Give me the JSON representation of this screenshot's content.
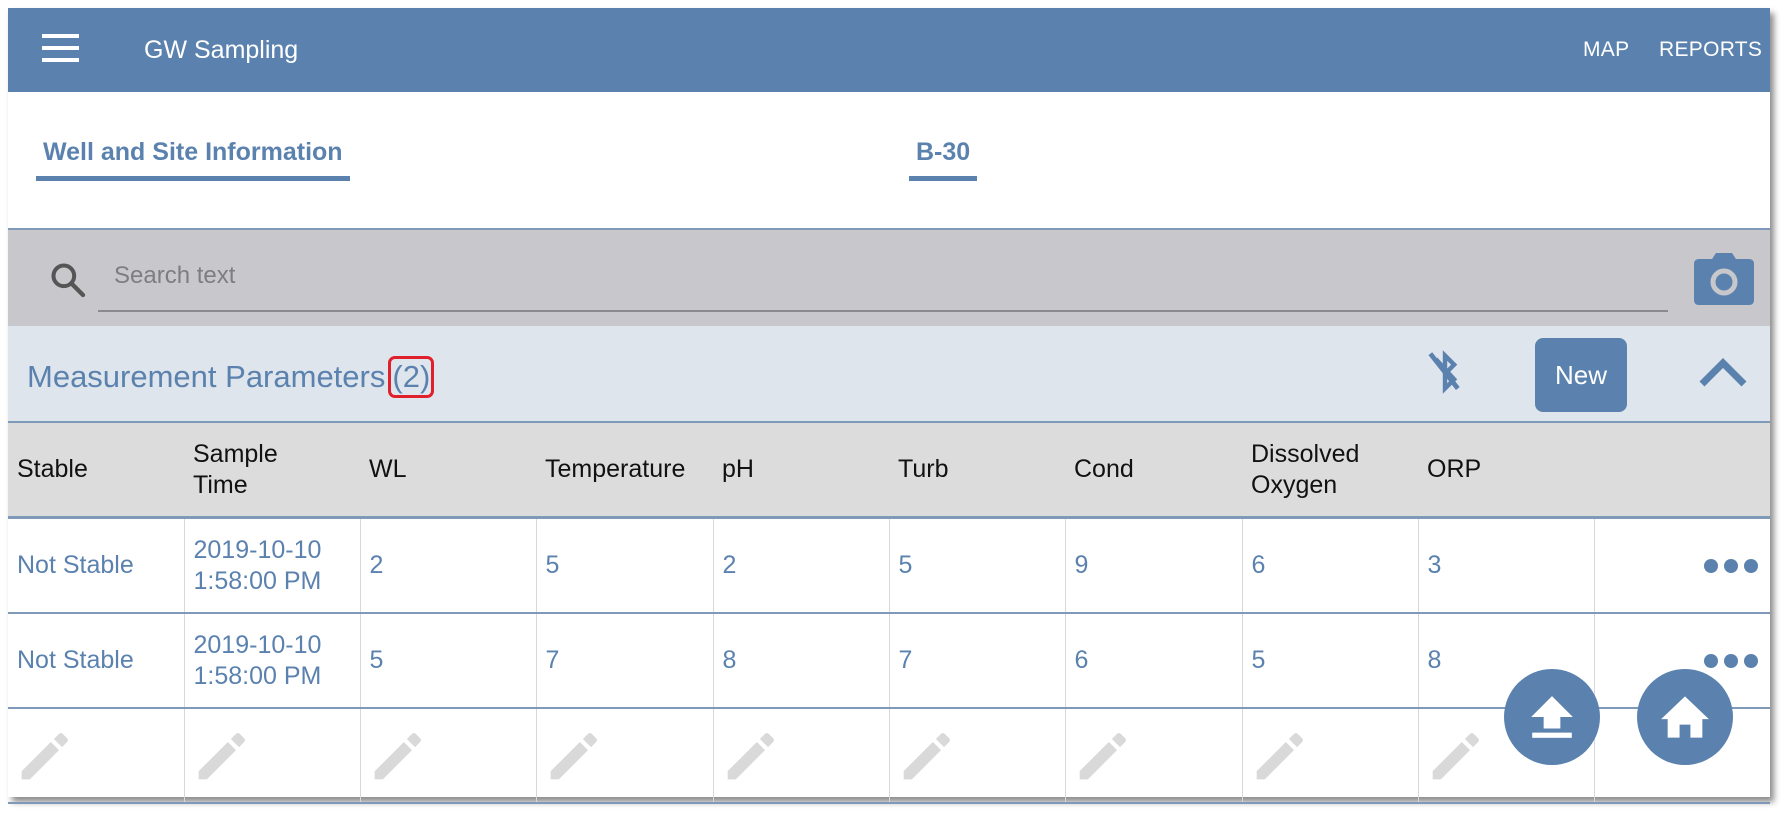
{
  "app": {
    "title": "GW Sampling",
    "nav": [
      {
        "label": "MAP"
      },
      {
        "label": "REPORTS"
      }
    ]
  },
  "tabs": [
    {
      "label": "Well and Site Information"
    },
    {
      "label": "B-30"
    }
  ],
  "search": {
    "placeholder": "Search text",
    "value": ""
  },
  "section": {
    "title": "Measurement Parameters",
    "count": "(2)",
    "new_label": "New",
    "icons": {
      "bluetooth": "bluetooth-disabled-icon",
      "collapse": "chevron-up-icon",
      "camera": "camera-icon",
      "search": "search-icon"
    }
  },
  "table": {
    "columns": [
      "Stable",
      "Sample\nTime",
      "WL",
      "Temperature",
      "pH",
      "Turb",
      "Cond",
      "Dissolved\nOxygen",
      "ORP",
      ""
    ],
    "columns_display": {
      "stable": "Stable",
      "sample_time_1": "Sample",
      "sample_time_2": "Time",
      "wl": "WL",
      "temperature": "Temperature",
      "ph": "pH",
      "turb": "Turb",
      "cond": "Cond",
      "dissolved_oxygen_1": "Dissolved",
      "dissolved_oxygen_2": "Oxygen",
      "orp": "ORP"
    },
    "rows": [
      {
        "stable": "Not Stable",
        "date": "2019-10-10",
        "time": "1:58:00 PM",
        "wl": "2",
        "temperature": "5",
        "ph": "2",
        "turb": "5",
        "cond": "9",
        "dissolved_oxygen": "6",
        "orp": "3"
      },
      {
        "stable": "Not Stable",
        "date": "2019-10-10",
        "time": "1:58:00 PM",
        "wl": "5",
        "temperature": "7",
        "ph": "8",
        "turb": "7",
        "cond": "6",
        "dissolved_oxygen": "5",
        "orp": "8"
      }
    ]
  },
  "fabs": {
    "upload": "upload-icon",
    "home": "home-icon"
  },
  "colors": {
    "primary": "#5b82ae",
    "search_bg": "#c8c8cc",
    "section_bg": "#dfe5ec",
    "header_bg": "#dcdcdc",
    "highlight": "#e0202a",
    "pencil": "#d9d9d9"
  }
}
